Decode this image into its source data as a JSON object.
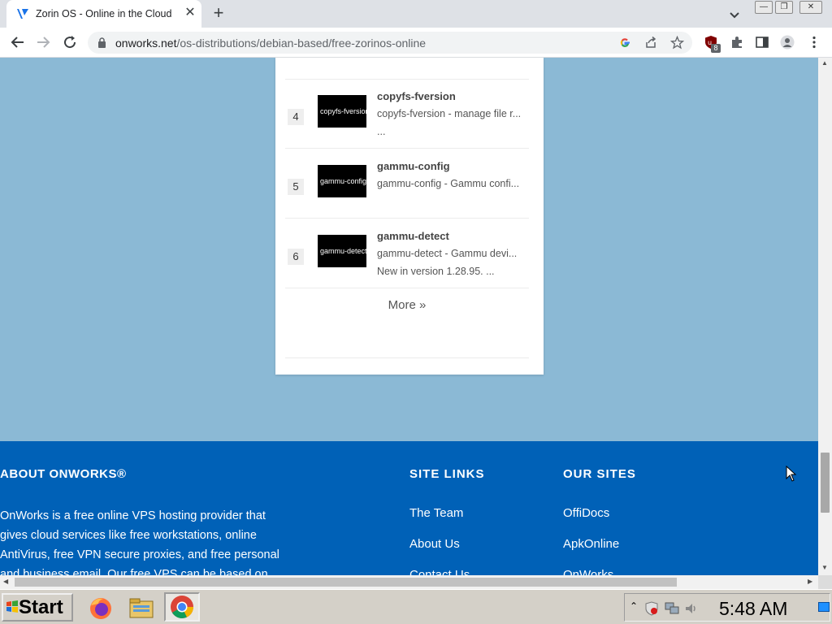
{
  "browser": {
    "tab_title": "Zorin OS - Online in the Cloud",
    "url_host": "onworks.net",
    "url_path": "/os-distributions/debian-based/free-zorinos-online",
    "extension_badge": "8"
  },
  "list": {
    "items": [
      {
        "number": "4",
        "thumb_label": "copyfs-fversion",
        "title": "copyfs-fversion",
        "desc1": "copyfs-fversion - manage file r...",
        "desc2": "..."
      },
      {
        "number": "5",
        "thumb_label": "gammu-config",
        "title": "gammu-config",
        "desc1": "gammu-config - Gammu confi...",
        "desc2": ""
      },
      {
        "number": "6",
        "thumb_label": "gammu-detect",
        "title": "gammu-detect",
        "desc1": "gammu-detect - Gammu devi...",
        "desc2": "New in version 1.28.95. ..."
      }
    ],
    "more_label": "More »"
  },
  "footer": {
    "about_heading": "ABOUT ONWORKS®",
    "about_lines": [
      "OnWorks is a free online VPS hosting provider that",
      "gives cloud services like free workstations, online",
      "AntiVirus, free VPN secure proxies, and free personal",
      "and business email. Our free VPS can be based on"
    ],
    "site_links_heading": "SITE LINKS",
    "site_links": [
      "The Team",
      "About Us",
      "Contact Us"
    ],
    "our_sites_heading": "OUR SITES",
    "our_sites": [
      "OffiDocs",
      "ApkOnline",
      "OnWorks"
    ]
  },
  "taskbar": {
    "start_label": "Start",
    "clock": "5:48 AM"
  },
  "colors": {
    "page_background": "#8bb9d5",
    "footer_background": "#0061b7"
  }
}
